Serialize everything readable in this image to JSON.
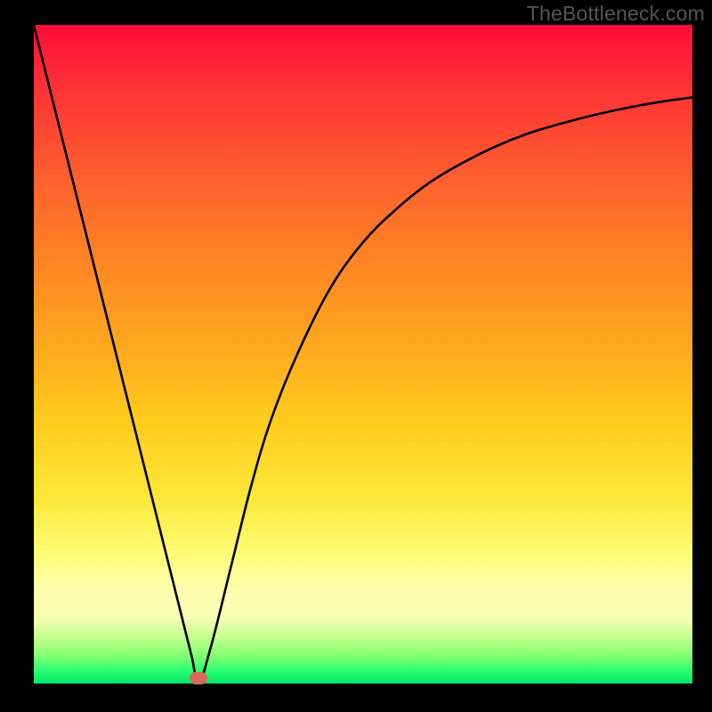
{
  "watermark": "TheBottleneck.com",
  "chart_data": {
    "type": "line",
    "title": "",
    "xlabel": "",
    "ylabel": "",
    "xlim": [
      0,
      100
    ],
    "ylim": [
      0,
      100
    ],
    "series": [
      {
        "name": "bottleneck-curve",
        "x": [
          0,
          5,
          10,
          15,
          18,
          20,
          22,
          24,
          25,
          27,
          30,
          33,
          36,
          40,
          45,
          50,
          55,
          60,
          65,
          70,
          75,
          80,
          85,
          90,
          95,
          100
        ],
        "values": [
          100,
          80,
          60,
          40,
          28,
          20,
          12,
          4,
          0,
          6,
          18,
          30,
          40,
          50,
          60,
          67,
          72,
          76,
          79,
          81.5,
          83.5,
          85,
          86.3,
          87.4,
          88.3,
          89
        ]
      }
    ],
    "marker": {
      "x": 25,
      "y": 0.8,
      "name": "optimal-point"
    },
    "gradient_stops": [
      {
        "pct": 0,
        "color": "#ff0a3a"
      },
      {
        "pct": 8,
        "color": "#ff2d37"
      },
      {
        "pct": 22,
        "color": "#ff5b2f"
      },
      {
        "pct": 35,
        "color": "#ff8224"
      },
      {
        "pct": 48,
        "color": "#ffa61e"
      },
      {
        "pct": 60,
        "color": "#ffcb1c"
      },
      {
        "pct": 72,
        "color": "#fde83a"
      },
      {
        "pct": 80,
        "color": "#fffb74"
      },
      {
        "pct": 86,
        "color": "#ffffb0"
      },
      {
        "pct": 90,
        "color": "#f7ffb4"
      },
      {
        "pct": 93,
        "color": "#c3ff8e"
      },
      {
        "pct": 96,
        "color": "#7cff70"
      },
      {
        "pct": 98,
        "color": "#2dff72"
      },
      {
        "pct": 100,
        "color": "#00e868"
      }
    ]
  }
}
